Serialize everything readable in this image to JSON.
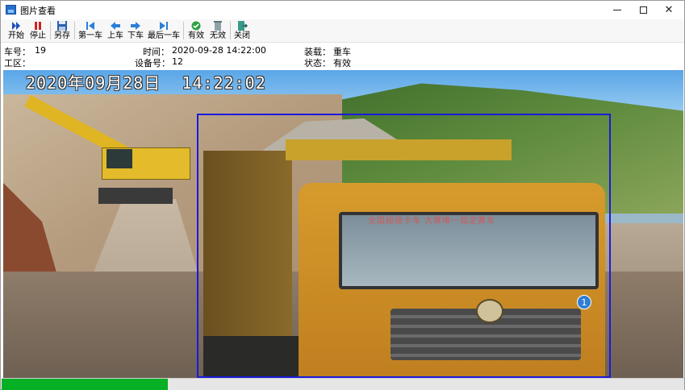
{
  "window": {
    "title": "图片查看",
    "controls": {
      "minimize": "—",
      "maximize": "□",
      "close": "✕"
    }
  },
  "toolbar": {
    "start_label": "开始",
    "stop_label": "停止",
    "save_as_label": "另存",
    "first_label": "第一车",
    "prev_label": "上车",
    "next_label": "下车",
    "last_label": "最后一车",
    "valid_label": "有效",
    "invalid_label": "无效",
    "close_label": "关闭",
    "icons": [
      "play-forward-icon",
      "stop-icon",
      "save-disk-icon",
      "first-record-icon",
      "previous-arrow-icon",
      "next-arrow-icon",
      "last-record-icon",
      "check-circle-icon",
      "trash-icon",
      "exit-door-icon"
    ]
  },
  "info": {
    "vehicle_no_label": "车号：",
    "vehicle_no_value": "19",
    "time_label": "时间：",
    "time_value": "2020-09-28 14:22:00",
    "load_label": "装载：",
    "load_value": "重车",
    "work_area_label": "工区：",
    "work_area_value": "",
    "device_no_label": "设备号：",
    "device_no_value": "12",
    "status_label": "状态：",
    "status_value": "有效"
  },
  "photo": {
    "overlay_timestamp": "2020年09月28日  14:22:02",
    "windshield_banner": "全国超级卡车    大赛唯一指定赛车",
    "detection_badge": "1"
  },
  "progress": {
    "fraction": 0.243,
    "color": "#06b025"
  }
}
